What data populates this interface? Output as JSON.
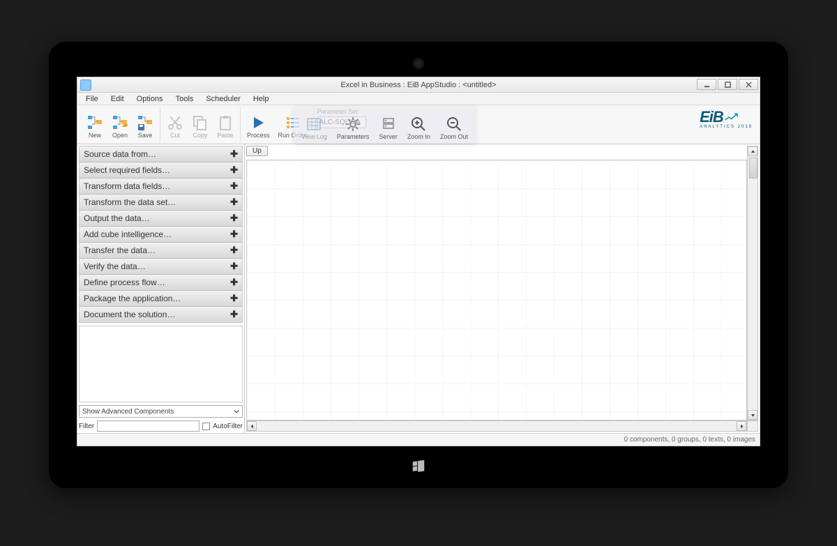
{
  "window": {
    "title": "Excel in Business : EiB AppStudio : <untitled>"
  },
  "menu": [
    "File",
    "Edit",
    "Options",
    "Tools",
    "Scheduler",
    "Help"
  ],
  "toolbar": {
    "new": "New",
    "open": "Open",
    "save": "Save",
    "cut": "Cut",
    "copy": "Copy",
    "paste": "Paste",
    "process": "Process",
    "run_order": "Run Order",
    "param_label": "Parameter Set",
    "param_value": "ALC-SQLIDA",
    "view_log": "View Log",
    "parameters": "Parameters",
    "server": "Server",
    "zoom_in": "Zoom In",
    "zoom_out": "Zoom Out"
  },
  "brand": {
    "name": "EiB",
    "sub": "ANALYTICS",
    "year": "2018"
  },
  "sidebar": {
    "categories": [
      "Source data from…",
      "Select required fields…",
      "Transform data fields…",
      "Transform the data set…",
      "Output the data…",
      "Add cube intelligence…",
      "Transfer the data…",
      "Verify the data…",
      "Define process flow…",
      "Package the application…",
      "Document the solution…"
    ],
    "advanced": "Show Advanced Components",
    "filter_label": "Filter",
    "auto_filter": "AutoFilter"
  },
  "canvas": {
    "up": "Up"
  },
  "status": "0 components, 0 groups, 0 texts, 0 images"
}
